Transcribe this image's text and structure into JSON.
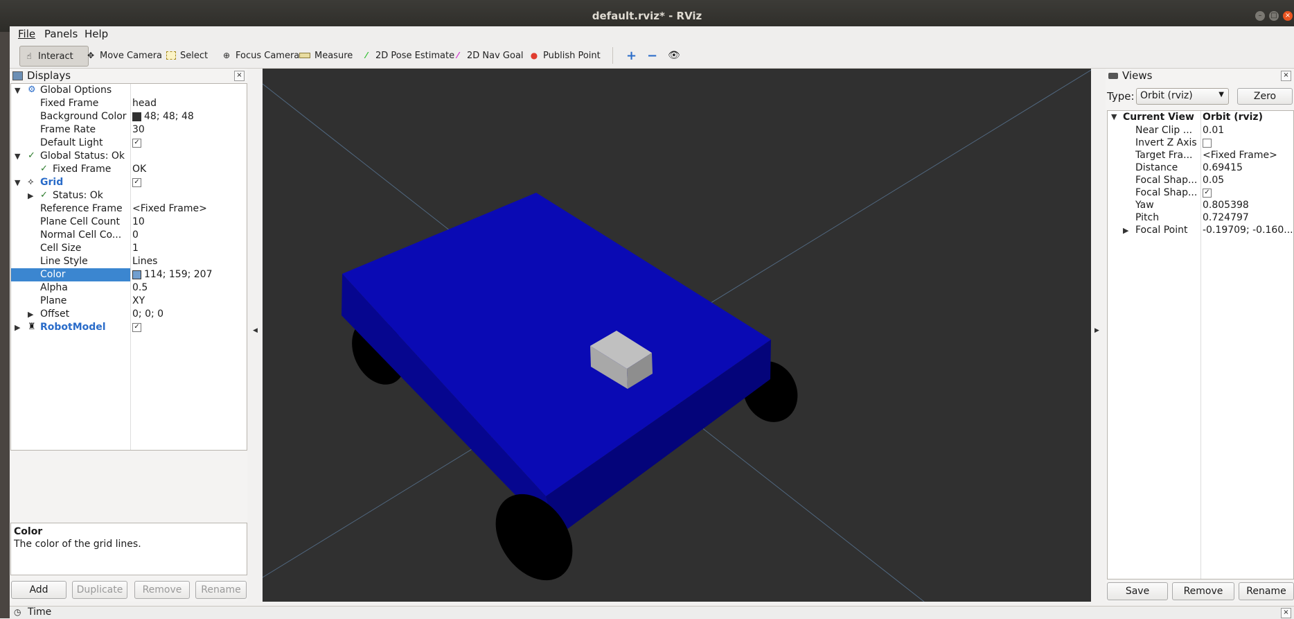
{
  "window": {
    "title": "default.rviz* - RViz"
  },
  "menu": [
    "File",
    "Panels",
    "Help"
  ],
  "toolbar": [
    {
      "label": "Interact",
      "icon": "hand-icon",
      "active": true
    },
    {
      "label": "Move Camera",
      "icon": "move-camera-icon"
    },
    {
      "label": "Select",
      "icon": "select-box-icon"
    },
    {
      "label": "Focus Camera",
      "icon": "focus-camera-icon"
    },
    {
      "label": "Measure",
      "icon": "ruler-icon"
    },
    {
      "label": "2D Pose Estimate",
      "icon": "green-arrow-icon",
      "color": "#2fbf2f"
    },
    {
      "label": "2D Nav Goal",
      "icon": "pink-arrow-icon",
      "color": "#d22fd2"
    },
    {
      "label": "Publish Point",
      "icon": "map-pin-icon",
      "color": "#e03c2f"
    }
  ],
  "displays": {
    "title": "Displays",
    "rows": [
      {
        "name": "Global Options",
        "value": "",
        "indent": 1,
        "expand": "open",
        "icon": "gear-icon"
      },
      {
        "name": "Fixed Frame",
        "value": "head",
        "indent": 2
      },
      {
        "name": "Background Color",
        "value": "48; 48; 48",
        "indent": 2,
        "swatch": "#303030"
      },
      {
        "name": "Frame Rate",
        "value": "30",
        "indent": 2
      },
      {
        "name": "Default Light",
        "value": "",
        "indent": 2,
        "checkbox": true
      },
      {
        "name": "Global Status: Ok",
        "value": "",
        "indent": 1,
        "expand": "open",
        "icon": "check-icon"
      },
      {
        "name": "Fixed Frame",
        "value": "OK",
        "indent": 3,
        "icon": "check-icon"
      },
      {
        "name": "Grid",
        "value": "",
        "indent": 1,
        "expand": "open",
        "icon": "grid-icon",
        "blue": true,
        "checkbox": true
      },
      {
        "name": "Status: Ok",
        "value": "",
        "indent": 3,
        "expand": "closed",
        "icon": "check-icon"
      },
      {
        "name": "Reference Frame",
        "value": "<Fixed Frame>",
        "indent": 2
      },
      {
        "name": "Plane Cell Count",
        "value": "10",
        "indent": 2
      },
      {
        "name": "Normal Cell Co...",
        "value": "0",
        "indent": 2
      },
      {
        "name": "Cell Size",
        "value": "1",
        "indent": 2
      },
      {
        "name": "Line Style",
        "value": "Lines",
        "indent": 2
      },
      {
        "name": "Color",
        "value": "114; 159; 207",
        "indent": 2,
        "swatch": "#729fcf",
        "selected": true
      },
      {
        "name": "Alpha",
        "value": "0.5",
        "indent": 2
      },
      {
        "name": "Plane",
        "value": "XY",
        "indent": 2
      },
      {
        "name": "Offset",
        "value": "0; 0; 0",
        "indent": 2,
        "expand": "closed"
      },
      {
        "name": "RobotModel",
        "value": "",
        "indent": 1,
        "expand": "closed",
        "icon": "robot-icon",
        "blue": true,
        "checkbox": true
      }
    ],
    "desc_title": "Color",
    "desc_text": "The color of the grid lines.",
    "buttons": {
      "add": "Add",
      "duplicate": "Duplicate",
      "remove": "Remove",
      "rename": "Rename"
    }
  },
  "views": {
    "title": "Views",
    "type_label": "Type:",
    "type_value": "Orbit (rviz)",
    "zero": "Zero",
    "header": {
      "name": "Current View",
      "value": "Orbit (rviz)"
    },
    "rows": [
      {
        "name": "Near Clip ...",
        "value": "0.01"
      },
      {
        "name": "Invert Z Axis",
        "value": "",
        "checkbox": false
      },
      {
        "name": "Target Fra...",
        "value": "<Fixed Frame>"
      },
      {
        "name": "Distance",
        "value": "0.69415"
      },
      {
        "name": "Focal Shap...",
        "value": "0.05"
      },
      {
        "name": "Focal Shap...",
        "value": "",
        "checkbox": true
      },
      {
        "name": "Yaw",
        "value": "0.805398"
      },
      {
        "name": "Pitch",
        "value": "0.724797"
      },
      {
        "name": "Focal Point",
        "value": "-0.19709; -0.160...",
        "expand": "closed"
      }
    ],
    "buttons": {
      "save": "Save",
      "remove": "Remove",
      "rename": "Rename"
    }
  },
  "time_panel": {
    "title": "Time"
  },
  "colors": {
    "robot_body": "#0a0aa8",
    "background": "#303030",
    "grid": "#729fcf"
  }
}
